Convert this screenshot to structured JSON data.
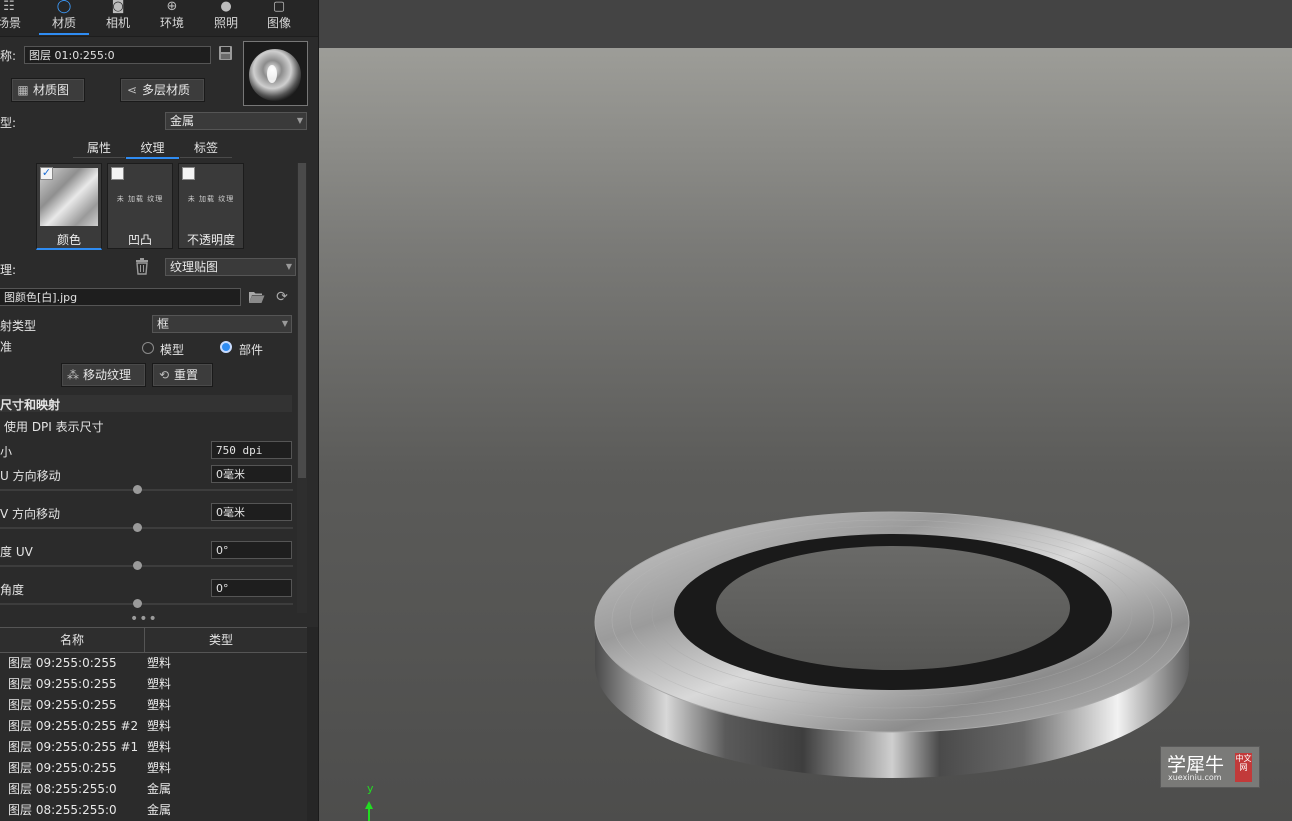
{
  "tabs": [
    {
      "label": "场景",
      "icon": "scene-icon"
    },
    {
      "label": "材质",
      "icon": "material-icon"
    },
    {
      "label": "相机",
      "icon": "camera-icon"
    },
    {
      "label": "环境",
      "icon": "globe-icon"
    },
    {
      "label": "照明",
      "icon": "bulb-icon"
    },
    {
      "label": "图像",
      "icon": "image-icon"
    }
  ],
  "material": {
    "name_label": "称:",
    "name_value": "图层 01:0:255:0",
    "graph_button": "材质图",
    "multilayer_button": "多层材质",
    "type_label": "型:",
    "type_value": "金属"
  },
  "subtabs": [
    "属性",
    "纹理",
    "标签"
  ],
  "textures": [
    {
      "label": "颜色",
      "checked": true,
      "empty_text": ""
    },
    {
      "label": "凹凸",
      "checked": false,
      "empty_text": "未 加载 纹理"
    },
    {
      "label": "不透明度",
      "checked": false,
      "empty_text": "未 加载 纹理"
    }
  ],
  "texture_settings": {
    "texture_label": "理:",
    "texture_type": "纹理贴图",
    "file_name": "图颜色[白].jpg",
    "map_type_label": "射类型",
    "map_type_value": "框",
    "reference_label": "准",
    "radio_model": "模型",
    "radio_part": "部件",
    "radio_selected": "部件",
    "move_button": "移动纹理",
    "reset_button": "重置"
  },
  "size_section": {
    "title": "尺寸和映射",
    "dpi_checkbox": "使用 DPI 表示尺寸",
    "size_label": "小",
    "size_value": "750 dpi",
    "u_label": "U 方向移动",
    "u_value": "0毫米",
    "v_label": "V 方向移动",
    "v_value": "0毫米",
    "uv_label": "度 UV",
    "uv_value": "0°",
    "angle_label": "角度",
    "angle_value": "0°"
  },
  "list": {
    "col_name": "名称",
    "col_type": "类型",
    "rows": [
      {
        "name": "图层 09:255:0:255",
        "type": "塑料"
      },
      {
        "name": "图层 09:255:0:255",
        "type": "塑料"
      },
      {
        "name": "图层 09:255:0:255",
        "type": "塑料"
      },
      {
        "name": "图层 09:255:0:255  #2",
        "type": "塑料"
      },
      {
        "name": "图层 09:255:0:255  #1",
        "type": "塑料"
      },
      {
        "name": "图层 09:255:0:255",
        "type": "塑料"
      },
      {
        "name": "图层 08:255:255:0",
        "type": "金属"
      },
      {
        "name": "图层 08:255:255:0",
        "type": "金属"
      }
    ]
  },
  "viewport": {
    "axis_label": "y",
    "watermark_main": "学犀牛",
    "watermark_url": "xuexiniu.com",
    "watermark_badge": "中文网"
  },
  "colors": {
    "accent": "#2f8cf2",
    "axis": "#22dd22"
  }
}
